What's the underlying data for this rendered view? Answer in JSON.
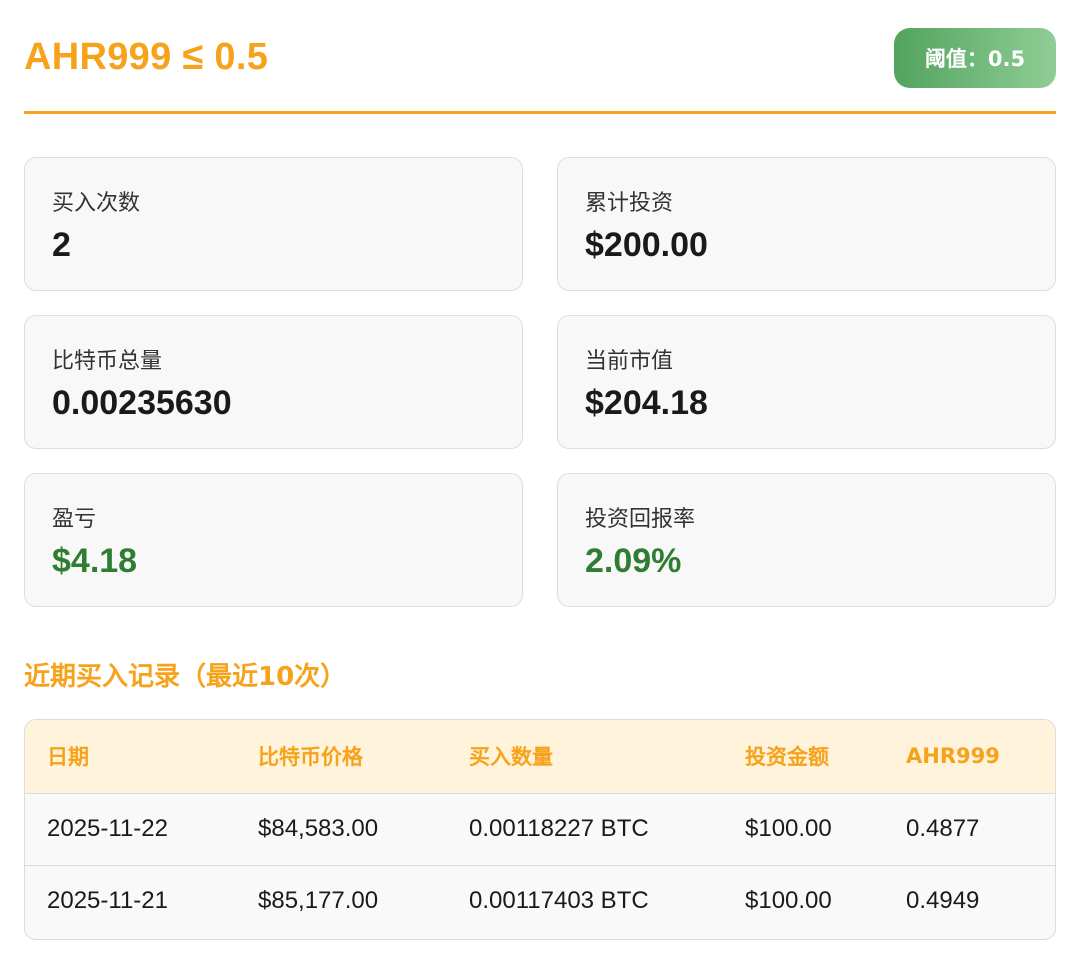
{
  "header": {
    "title": "AHR999 ≤ 0.5",
    "threshold_badge": "阈值：0.5"
  },
  "stats": {
    "buy_count": {
      "label": "买入次数",
      "value": "2"
    },
    "total_invested": {
      "label": "累计投资",
      "value": "$200.00"
    },
    "btc_total": {
      "label": "比特币总量",
      "value": "0.00235630"
    },
    "market_value": {
      "label": "当前市值",
      "value": "$204.18"
    },
    "profit_loss": {
      "label": "盈亏",
      "value": "$4.18"
    },
    "roi": {
      "label": "投资回报率",
      "value": "2.09%"
    }
  },
  "colors": {
    "accent": "#f7a21b",
    "positive": "#2e7d32",
    "badge_from": "#52a35e",
    "badge_to": "#8fcd96"
  },
  "records": {
    "title": "近期买入记录（最近10次）",
    "columns": [
      "日期",
      "比特币价格",
      "买入数量",
      "投资金额",
      "AHR999"
    ],
    "rows": [
      [
        "2025-11-22",
        "$84,583.00",
        "0.00118227 BTC",
        "$100.00",
        "0.4877"
      ],
      [
        "2025-11-21",
        "$85,177.00",
        "0.00117403 BTC",
        "$100.00",
        "0.4949"
      ]
    ]
  }
}
